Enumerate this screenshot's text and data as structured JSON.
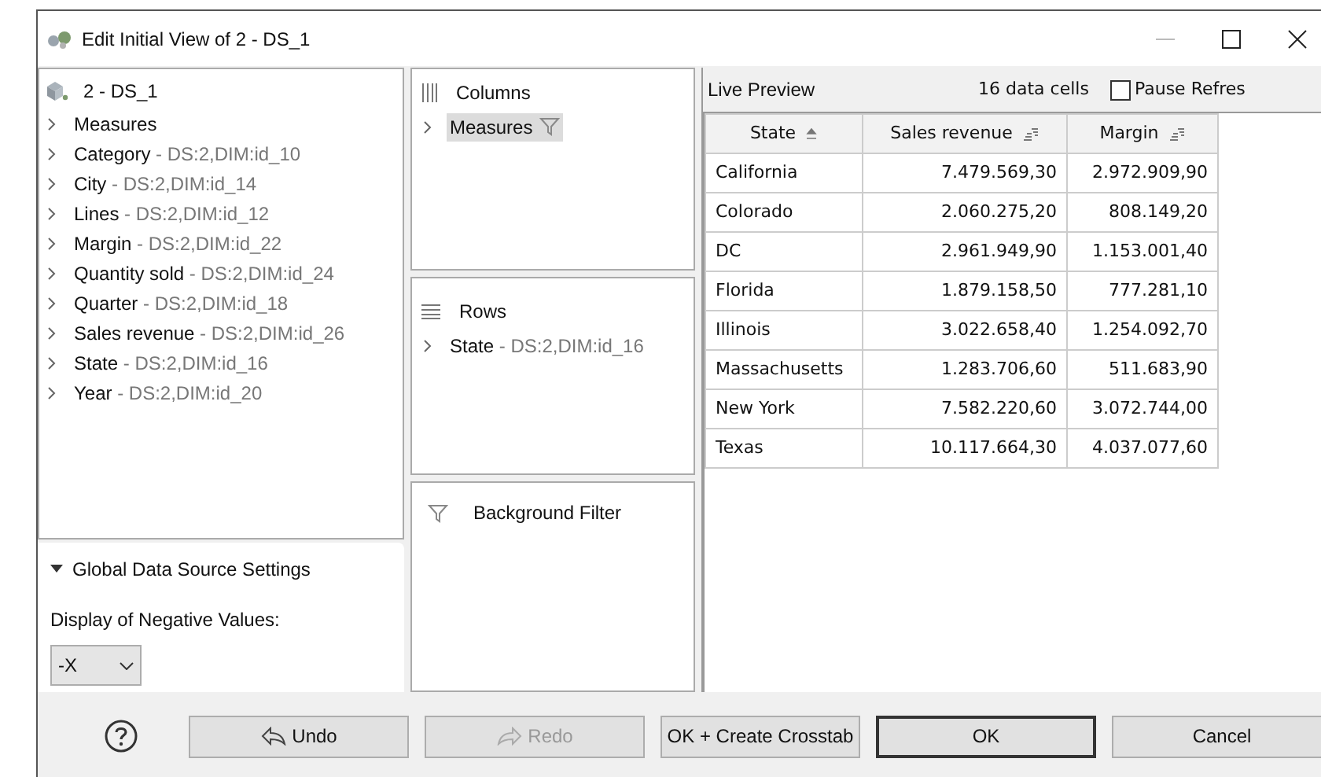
{
  "window": {
    "title": "Edit Initial View of 2 - DS_1"
  },
  "source_tree": {
    "root": "2 - DS_1",
    "items": [
      {
        "name": "Measures",
        "expanded": false
      },
      {
        "name": "Category",
        "detail": " - DS:2,DIM:id_10",
        "expanded": false
      },
      {
        "name": "City",
        "detail": " - DS:2,DIM:id_14",
        "expanded": false
      },
      {
        "name": "Lines",
        "detail": " - DS:2,DIM:id_12",
        "expanded": false
      },
      {
        "name": "Margin",
        "detail": " - DS:2,DIM:id_22",
        "expanded": false
      },
      {
        "name": "Quantity sold",
        "detail": " - DS:2,DIM:id_24",
        "expanded": false
      },
      {
        "name": "Quarter",
        "detail": " - DS:2,DIM:id_18",
        "expanded": false
      },
      {
        "name": "Sales revenue",
        "detail": " - DS:2,DIM:id_26",
        "expanded": false
      },
      {
        "name": "State",
        "detail": " - DS:2,DIM:id_16",
        "expanded": false
      },
      {
        "name": "Year",
        "detail": " - DS:2,DIM:id_20",
        "expanded": false
      }
    ]
  },
  "global_settings": {
    "title": "Global Data Source Settings",
    "expanded": true,
    "negative_values_label": "Display of Negative Values:",
    "negative_values": "-X"
  },
  "columns": {
    "title": "Columns",
    "items": [
      {
        "name": "Measures",
        "selected": true,
        "filter": true,
        "expanded": false
      }
    ]
  },
  "rows": {
    "title": "Rows",
    "items": [
      {
        "name": "State",
        "detail": " - DS:2,DIM:id_16",
        "selected": false,
        "filter": false,
        "expanded": false
      }
    ]
  },
  "background_filter": {
    "title": "Background Filter"
  },
  "live_preview": {
    "title": "Live Preview",
    "cells": "16 data cells",
    "pause_label": "Pause Refres",
    "pause_checked": false
  },
  "table": {
    "columns": [
      {
        "label": "State",
        "kind": "ascending"
      },
      {
        "label": "Sales revenue",
        "kind": "measure"
      },
      {
        "label": "Margin",
        "kind": "measure"
      }
    ],
    "rows": [
      [
        "California",
        "7.479.569,30",
        "2.972.909,90"
      ],
      [
        "Colorado",
        "2.060.275,20",
        "808.149,20"
      ],
      [
        "DC",
        "2.961.949,90",
        "1.153.001,40"
      ],
      [
        "Florida",
        "1.879.158,50",
        "777.281,10"
      ],
      [
        "Illinois",
        "3.022.658,40",
        "1.254.092,70"
      ],
      [
        "Massachusetts",
        "1.283.706,60",
        "511.683,90"
      ],
      [
        "New York",
        "7.582.220,60",
        "3.072.744,00"
      ],
      [
        "Texas",
        "10.117.664,30",
        "4.037.077,60"
      ]
    ]
  },
  "buttons": [
    {
      "label": "Undo",
      "kind": "undo",
      "disabled": false,
      "default": false
    },
    {
      "label": "Redo",
      "kind": "redo",
      "disabled": true,
      "default": false
    },
    {
      "label": "OK + Create Crosstab",
      "kind": "plain",
      "disabled": false,
      "default": false
    },
    {
      "label": "OK",
      "kind": "plain",
      "disabled": false,
      "default": true
    },
    {
      "label": "Cancel",
      "kind": "plain",
      "disabled": false,
      "default": false
    }
  ]
}
